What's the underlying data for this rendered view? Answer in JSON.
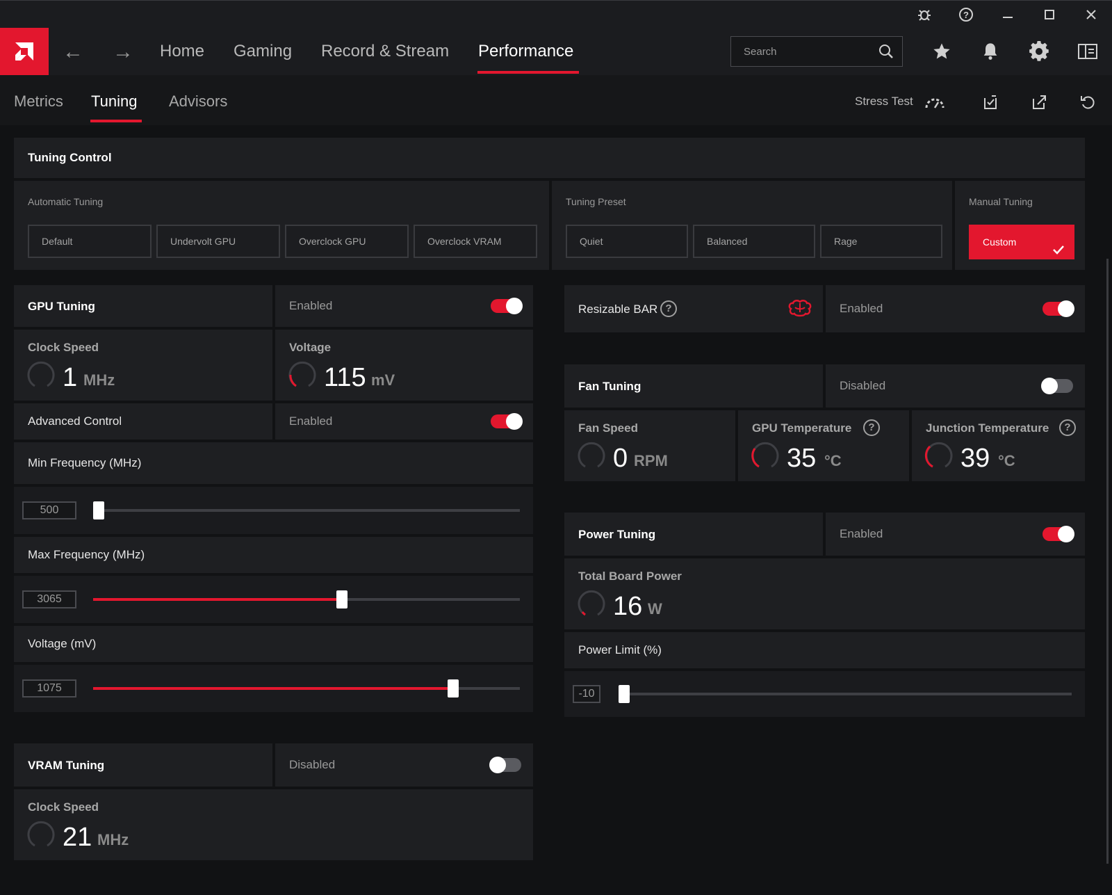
{
  "nav": {
    "items": [
      "Home",
      "Gaming",
      "Record & Stream",
      "Performance"
    ],
    "search_placeholder": "Search"
  },
  "subnav": {
    "tabs": [
      "Metrics",
      "Tuning",
      "Advisors"
    ],
    "stress_test": "Stress Test"
  },
  "tuning_control": {
    "title": "Tuning Control",
    "automatic_label": "Automatic Tuning",
    "automatic_options": [
      "Default",
      "Undervolt GPU",
      "Overclock GPU",
      "Overclock VRAM"
    ],
    "preset_label": "Tuning Preset",
    "preset_options": [
      "Quiet",
      "Balanced",
      "Rage"
    ],
    "manual_label": "Manual Tuning",
    "manual_option": "Custom"
  },
  "gpu_tuning": {
    "title": "GPU Tuning",
    "status": "Enabled",
    "enabled": true,
    "clock_label": "Clock Speed",
    "clock_value": "1",
    "clock_unit": "MHz",
    "voltage_label": "Voltage",
    "voltage_value": "115",
    "voltage_unit": "mV",
    "advanced_label": "Advanced Control",
    "advanced_status": "Enabled",
    "advanced_enabled": true,
    "min_freq_label": "Min Frequency (MHz)",
    "min_freq_value": "500",
    "min_freq_fraction": 0.0,
    "max_freq_label": "Max Frequency (MHz)",
    "max_freq_value": "3065",
    "max_freq_fraction": 0.57,
    "voltage_slider_label": "Voltage (mV)",
    "voltage_slider_value": "1075",
    "voltage_slider_fraction": 0.83
  },
  "vram_tuning": {
    "title": "VRAM Tuning",
    "status": "Disabled",
    "enabled": false,
    "clock_label": "Clock Speed",
    "clock_value": "21",
    "clock_unit": "MHz"
  },
  "resizable_bar": {
    "title": "Resizable BAR",
    "status": "Enabled",
    "enabled": true
  },
  "fan_tuning": {
    "title": "Fan Tuning",
    "status": "Disabled",
    "enabled": false,
    "fan_speed_label": "Fan Speed",
    "fan_speed_value": "0",
    "fan_speed_unit": "RPM",
    "gpu_temp_label": "GPU Temperature",
    "gpu_temp_value": "35",
    "gpu_temp_unit": "°C",
    "junction_temp_label": "Junction Temperature",
    "junction_temp_value": "39",
    "junction_temp_unit": "°C"
  },
  "power_tuning": {
    "title": "Power Tuning",
    "status": "Enabled",
    "enabled": true,
    "board_power_label": "Total Board Power",
    "board_power_value": "16",
    "board_power_unit": "W",
    "power_limit_label": "Power Limit (%)",
    "power_limit_value": "-10",
    "power_limit_fraction": 0.0
  },
  "colors": {
    "accent": "#e3172e",
    "background": "#111214",
    "panel": "#1e1f22"
  }
}
